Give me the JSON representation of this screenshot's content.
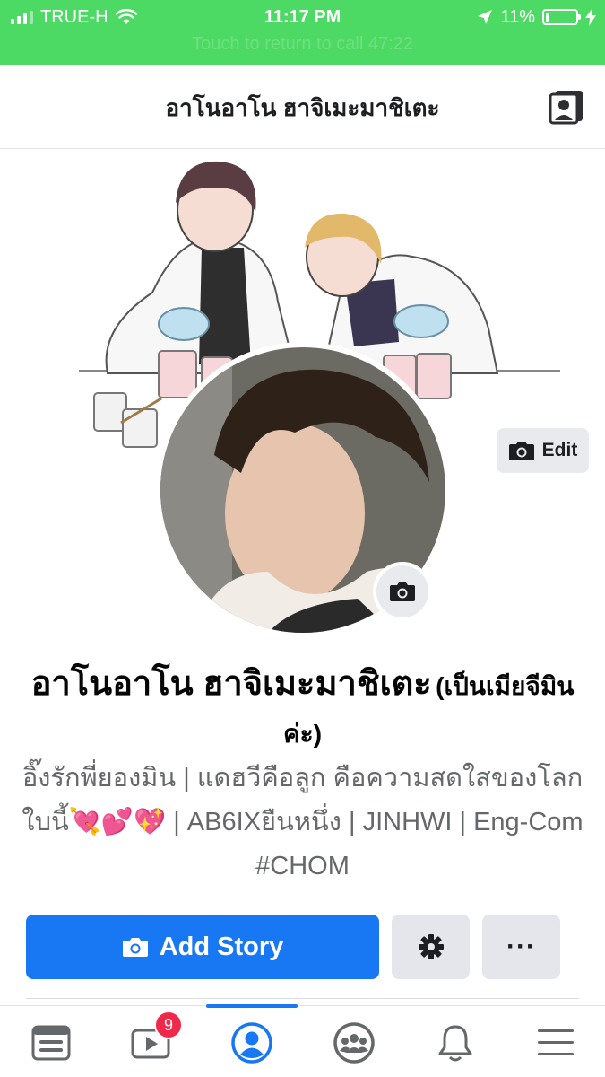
{
  "status_bar": {
    "carrier": "TRUE-H",
    "time": "11:17 PM",
    "battery": "11%",
    "battery_level": 0.11,
    "call_banner": "Touch to return to call 47:22"
  },
  "header": {
    "title": "อาโนอาโน ฮาจิเมะมาชิเตะ",
    "icon": "profile-switch-icon"
  },
  "cover": {
    "edit_label": "Edit",
    "icon": "camera-icon"
  },
  "profile": {
    "name": "อาโนอาโน ฮาจิเมะมาชิเตะ",
    "name_suffix": "(เป็นเมียจีมินค่ะ)",
    "bio": "อิ๊งรักพี่ยองมิน | แดฮวีคือลูก คือความสดใสของโลกใบนี้💘💕💖 | AB6IXยืนหนึ่ง | JINHWI | Eng-Com #CHOM"
  },
  "actions": {
    "add_story_label": "Add Story",
    "more_label": "···",
    "settings_icon": "gear-icon",
    "more_icon": "more-icon"
  },
  "tab_bar": {
    "tabs": [
      {
        "name": "news-feed",
        "icon": "news-feed-icon"
      },
      {
        "name": "watch",
        "icon": "watch-icon",
        "badge": "9"
      },
      {
        "name": "profile",
        "icon": "profile-icon",
        "active": true
      },
      {
        "name": "groups",
        "icon": "groups-icon"
      },
      {
        "name": "notifications",
        "icon": "bell-icon"
      },
      {
        "name": "menu",
        "icon": "menu-icon"
      }
    ]
  },
  "colors": {
    "status_bar": "#4cd964",
    "accent": "#1877f2",
    "badge": "#f02849",
    "button_gray": "#e4e6eb"
  }
}
